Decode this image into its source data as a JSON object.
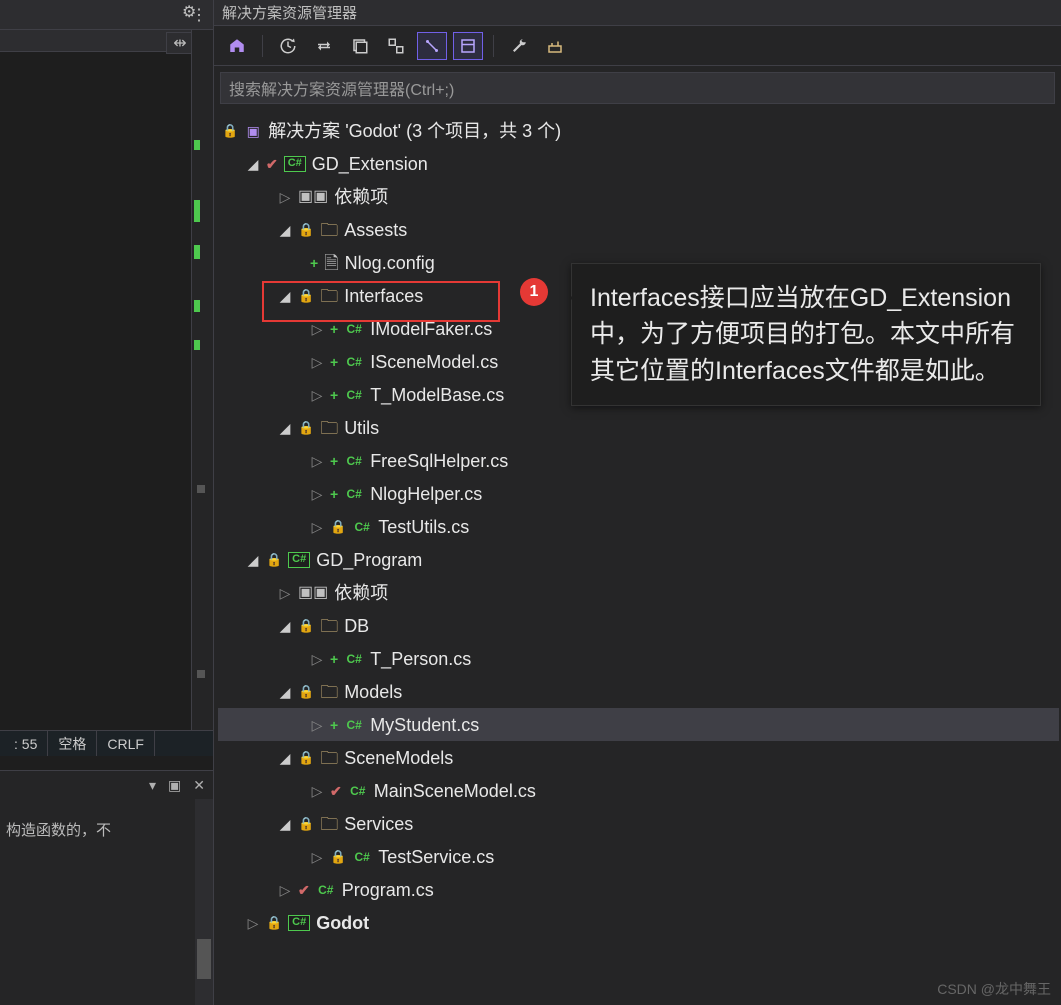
{
  "left": {
    "status_col": ": 55",
    "status_space": "空格",
    "status_eol": "CRLF",
    "lower_hdr_arrow": "▾",
    "lower_hdr_pin": "📌",
    "lower_hdr_close": "✕",
    "lower_text": "构造函数的，不",
    "combo_arrow": "▾",
    "split_glyph": "⇹"
  },
  "explorer": {
    "title": "解决方案资源管理器",
    "search_placeholder": "搜索解决方案资源管理器(Ctrl+;)",
    "solution": "解决方案 'Godot' (3 个项目，共 3 个)"
  },
  "callout": {
    "badge": "1",
    "text": "Interfaces接口应当放在GD_Extension中，为了方便项目的打包。本文中所有其它位置的Interfaces文件都是如此。"
  },
  "watermark": "CSDN @龙中舞王",
  "tree": {
    "gd_ext": "GD_Extension",
    "deps1": "依赖项",
    "assests": "Assests",
    "nlog": "Nlog.config",
    "interfaces": "Interfaces",
    "imodelfaker": "IModelFaker.cs",
    "iscenemodel": "ISceneModel.cs",
    "tmodelbase": "T_ModelBase.cs",
    "utils": "Utils",
    "freesql": "FreeSqlHelper.cs",
    "nloghelper": "NlogHelper.cs",
    "testutils": "TestUtils.cs",
    "gd_prog": "GD_Program",
    "deps2": "依赖项",
    "db": "DB",
    "tperson": "T_Person.cs",
    "models": "Models",
    "mystudent": "MyStudent.cs",
    "scenemodels": "SceneModels",
    "mainscene": "MainSceneModel.cs",
    "services": "Services",
    "testservice": "TestService.cs",
    "program": "Program.cs",
    "godot": "Godot"
  }
}
